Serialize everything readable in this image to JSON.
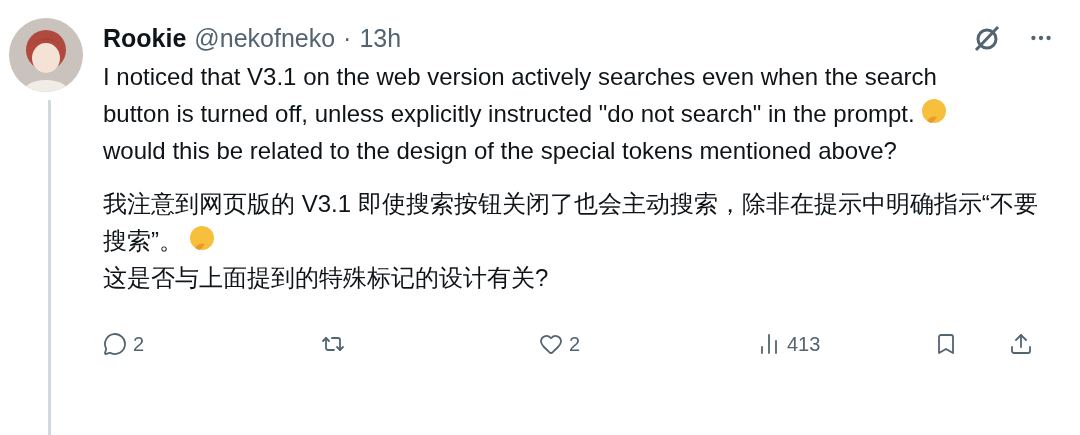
{
  "post": {
    "author": {
      "name": "Rookie",
      "handle": "@nekofneko",
      "separator": "·",
      "time": "13h"
    },
    "english": [
      {
        "text": "I noticed that V3.1 on the web version actively searches even when the search button is turned off, unless explicitly instructed \"do not search\" in the prompt.",
        "emoji": true
      },
      {
        "text": "would this be related to the design of the special tokens mentioned above?",
        "emoji": false
      }
    ],
    "chinese": [
      {
        "text": "我注意到网页版的 V3.1 即使搜索按钮关闭了也会主动搜索，除非在提示中明确指示“不要搜索”。",
        "emoji": true
      },
      {
        "text": "这是否与上面提到的特殊标记的设计有关?",
        "emoji": false
      }
    ],
    "actions": [
      {
        "kind": "reply",
        "count": "2"
      },
      {
        "kind": "repost"
      },
      {
        "kind": "like",
        "count": "2"
      },
      {
        "kind": "views",
        "count": "413"
      },
      {
        "kind": "bookmark"
      },
      {
        "kind": "share"
      }
    ]
  }
}
